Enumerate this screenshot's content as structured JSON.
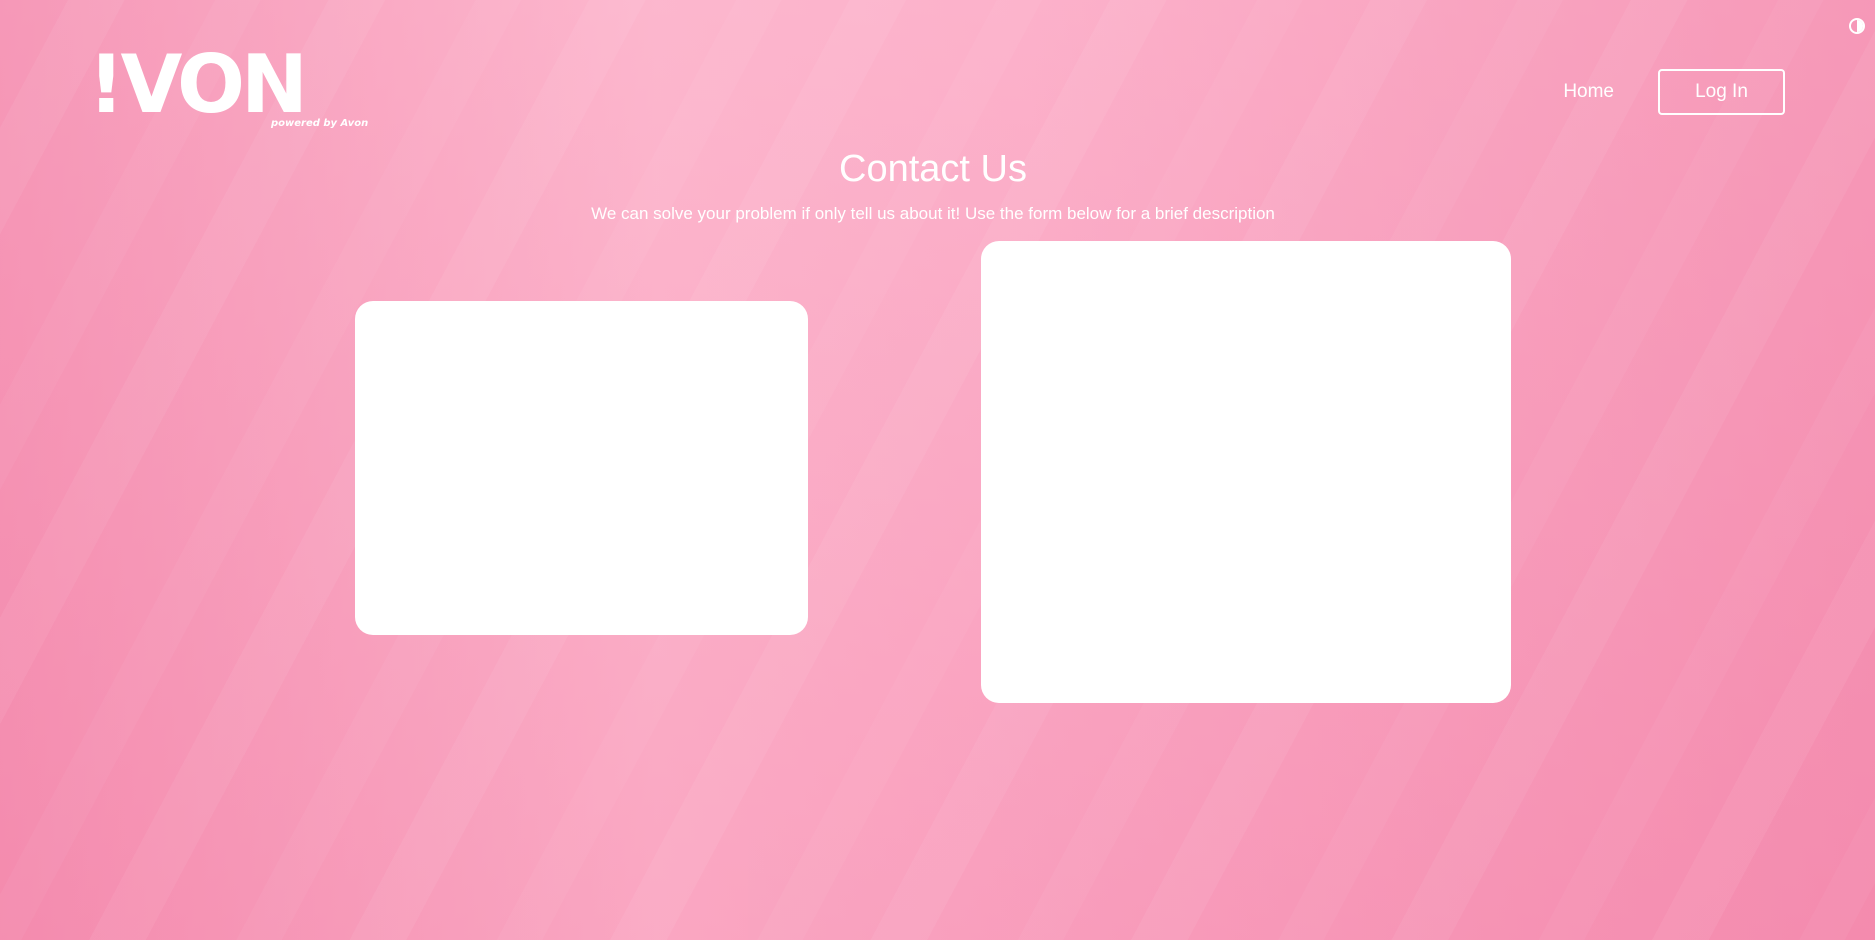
{
  "brand": {
    "logo_text": "!VON",
    "tagline": "powered by Avon"
  },
  "nav": {
    "home_label": "Home",
    "login_label": "Log In"
  },
  "theme_toggle": {
    "icon": "contrast-icon"
  },
  "hero": {
    "title": "Contact Us",
    "subtitle": "We can solve your problem if only tell us about it! Use the form below for a brief description"
  },
  "colors": {
    "background": "#f8a1bd",
    "text": "#ffffff",
    "card": "#ffffff"
  }
}
